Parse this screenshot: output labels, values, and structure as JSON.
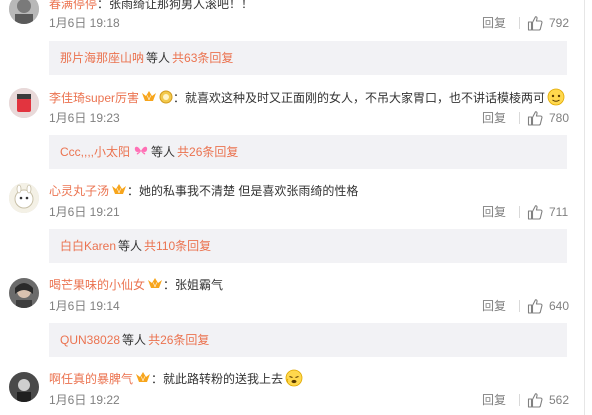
{
  "comments": [
    {
      "username": "春满停停",
      "text": "：张雨绮让那狗男人滚吧！！",
      "time": "1月6日 19:18",
      "reply_label": "回复",
      "likes": "792",
      "sub": {
        "name": "那片海那座山呐",
        "word": "等人",
        "count": "共63条回复"
      }
    },
    {
      "username": "李佳琦super厉害",
      "text": "：就喜欢这种及时又正面刚的女人，不吊大家胃口，也不讲话模棱两可",
      "time": "1月6日 19:23",
      "reply_label": "回复",
      "likes": "780",
      "sub": {
        "name": "Ccc,,,,小太阳",
        "word": "等人",
        "count": "共26条回复"
      }
    },
    {
      "username": "心灵丸子汤",
      "text": "：她的私事我不清楚 但是喜欢张雨绮的性格",
      "time": "1月6日 19:21",
      "reply_label": "回复",
      "likes": "711",
      "sub": {
        "name": "白白Karen",
        "word": "等人",
        "count": "共110条回复"
      }
    },
    {
      "username": "喝芒果味的小仙女",
      "text": "：张姐霸气",
      "time": "1月6日 19:14",
      "reply_label": "回复",
      "likes": "640",
      "sub": {
        "name": "QUN38028",
        "word": "等人",
        "count": "共26条回复"
      }
    },
    {
      "username": "啊任真的暴脾气",
      "text": "：就此路转粉的送我上去",
      "time": "1月6日 19:22",
      "reply_label": "回复",
      "likes": "562"
    }
  ],
  "colors": {
    "link": "#eb7350",
    "meta": "#808080",
    "subbox": "#f2f2f5"
  },
  "icons": [
    "avatar",
    "vip-badge-icon",
    "medal-icon",
    "emoji-icon",
    "thumbs-up-icon",
    "butterfly-icon"
  ]
}
